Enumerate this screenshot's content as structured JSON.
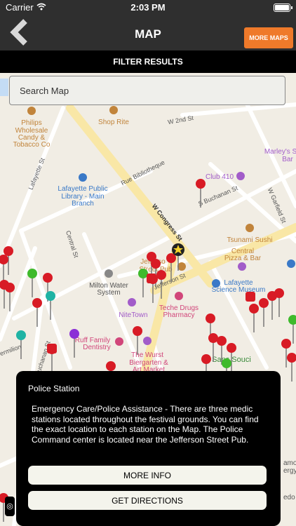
{
  "status_bar": {
    "carrier": "Carrier",
    "time": "2:03 PM"
  },
  "nav": {
    "title": "MAP",
    "more_maps_label": "MORE MAPS"
  },
  "filter": {
    "label": "FILTER RESULTS"
  },
  "search": {
    "placeholder": "Search Map"
  },
  "map": {
    "colors": {
      "water": "#c4dcf5",
      "land": "#f1ede4",
      "road": "#ffffff",
      "major_road": "#f9e7a6",
      "poi_orange": "#c1843b",
      "poi_blue": "#3a79c7",
      "poi_purple": "#a25cc9",
      "poi_pink": "#d1467a",
      "street_label": "#555555"
    },
    "pins": {
      "red": "#d81b25",
      "green": "#3fba2c",
      "teal": "#1fb3a4",
      "purple": "#8b2fd6"
    },
    "labels": {
      "philips": [
        "Philips",
        "Wholesale",
        "Candy &",
        "Tobacco Co"
      ],
      "shop_rite": "Shop Rite",
      "w2nd": "W 2nd St",
      "marleys": [
        "Marley's S",
        "Bar"
      ],
      "library": [
        "Lafayette Public",
        "Library - Main",
        "Branch"
      ],
      "rue": "Rue Bibliotheque",
      "club410": "Club 410",
      "s_buchanan": "S Buchanan St",
      "w_garfield": "W Garfield St",
      "lafayette_st": "Lafayette St",
      "central_st": "Central St",
      "w_congress": "W Congress St",
      "tsunami": "Tsunami Sushi",
      "central_pizza": [
        "Central",
        "Pizza & Bar"
      ],
      "jefferson_pub": [
        "Jefferso",
        "Street Pub"
      ],
      "milton": [
        "Milton Water",
        "System"
      ],
      "science_museum": [
        "Lafayette",
        "Science Museum"
      ],
      "jefferson_st": "Jefferson St",
      "nitetown": "NiteTown",
      "teche": [
        "Teche Drugs",
        "Pharmacy"
      ],
      "ruff": [
        "Ruff Family",
        "Dentistry"
      ],
      "wurst": [
        "The Wurst",
        "Biergarten &",
        "Art Market"
      ],
      "sans_souci": "Sans Souci",
      "vermilion": "ermilion",
      "buchanan_st": "Buchanan St",
      "amo": "amo",
      "ergy": "ergy",
      "edo": "edo"
    },
    "compass": "N"
  },
  "popup": {
    "title": "Police Station",
    "description": "Emergency Care/Police Assistance - There are three medic stations located throughout the festival grounds. You can find the exact location to each station on the Map.  The Police Command center is located near the Jefferson Street Pub.",
    "more_info_label": "MORE INFO",
    "get_directions_label": "GET DIRECTIONS"
  }
}
